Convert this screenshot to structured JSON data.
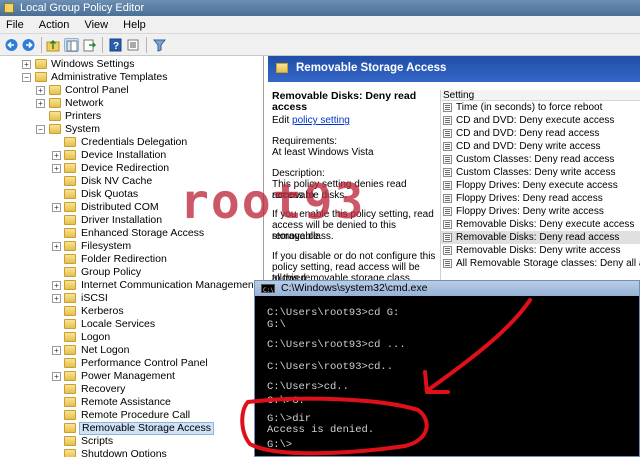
{
  "window": {
    "title": "Local Group Policy Editor"
  },
  "menu": [
    "File",
    "Action",
    "View",
    "Help"
  ],
  "toolbar": {
    "icons": [
      "back-arrow-icon",
      "forward-arrow-icon",
      "up-folder-icon",
      "show-hide-tree-icon",
      "export-list-icon",
      "help-icon",
      "properties-icon",
      "filter-icon"
    ]
  },
  "tree": {
    "items": [
      {
        "label": "Windows Settings",
        "exp": "+"
      },
      {
        "label": "Administrative Templates",
        "exp": "−"
      },
      {
        "label": "Control Panel",
        "exp": "+"
      },
      {
        "label": "Network",
        "exp": "+"
      },
      {
        "label": "Printers",
        "exp": ""
      },
      {
        "label": "System",
        "exp": "−"
      },
      {
        "label": "Credentials Delegation",
        "exp": ""
      },
      {
        "label": "Device Installation",
        "exp": "+"
      },
      {
        "label": "Device Redirection",
        "exp": "+"
      },
      {
        "label": "Disk NV Cache",
        "exp": ""
      },
      {
        "label": "Disk Quotas",
        "exp": ""
      },
      {
        "label": "Distributed COM",
        "exp": "+"
      },
      {
        "label": "Driver Installation",
        "exp": ""
      },
      {
        "label": "Enhanced Storage Access",
        "exp": ""
      },
      {
        "label": "Filesystem",
        "exp": "+"
      },
      {
        "label": "Folder Redirection",
        "exp": ""
      },
      {
        "label": "Group Policy",
        "exp": ""
      },
      {
        "label": "Internet Communication Management",
        "exp": "+"
      },
      {
        "label": "iSCSI",
        "exp": "+"
      },
      {
        "label": "Kerberos",
        "exp": ""
      },
      {
        "label": "Locale Services",
        "exp": ""
      },
      {
        "label": "Logon",
        "exp": ""
      },
      {
        "label": "Net Logon",
        "exp": "+"
      },
      {
        "label": "Performance Control Panel",
        "exp": ""
      },
      {
        "label": "Power Management",
        "exp": "+"
      },
      {
        "label": "Recovery",
        "exp": ""
      },
      {
        "label": "Remote Assistance",
        "exp": ""
      },
      {
        "label": "Remote Procedure Call",
        "exp": ""
      },
      {
        "label": "Removable Storage Access",
        "exp": ""
      },
      {
        "label": "Scripts",
        "exp": ""
      },
      {
        "label": "Shutdown Options",
        "exp": ""
      }
    ]
  },
  "right": {
    "header_title": "Removable Storage Access",
    "desc": {
      "heading": "Removable Disks: Deny read access",
      "edit_prefix": "Edit",
      "edit_link": "policy setting",
      "requirements_label": "Requirements:",
      "requirements_value": "At least Windows Vista",
      "description_label": "Description:",
      "p1a": "This policy setting denies read access to",
      "p1b": "removable disks.",
      "p2a": "If you enable this policy setting, read",
      "p2b": "access will be denied to this removable",
      "p2c": "storage class.",
      "p3a": "If you disable or do not configure this",
      "p3b": "policy setting, read access will be allowed",
      "p3c": "to this removable storage class."
    },
    "settings_header": "Setting",
    "settings": [
      "Time (in seconds) to force reboot",
      "CD and DVD: Deny execute access",
      "CD and DVD: Deny read access",
      "CD and DVD: Deny write access",
      "Custom Classes: Deny read access",
      "Custom Classes: Deny write access",
      "Floppy Drives: Deny execute access",
      "Floppy Drives: Deny read access",
      "Floppy Drives: Deny write access",
      "Removable Disks: Deny execute access",
      "Removable Disks: Deny read access",
      "Removable Disks: Deny write access",
      "All Removable Storage classes: Deny all access"
    ],
    "selected_setting_index": 10
  },
  "cmd": {
    "title": "C:\\Windows\\system32\\cmd.exe",
    "lines": [
      "C:\\Users\\root93>cd G:",
      "G:\\",
      "",
      "C:\\Users\\root93>cd ...",
      "",
      "C:\\Users\\root93>cd..",
      "",
      "C:\\Users>cd..",
      "",
      "C:\\>G:",
      "",
      "G:\\>dir",
      "Access is denied.",
      "",
      "G:\\>"
    ]
  },
  "watermark": "root93",
  "annotation_color": "#e0101a"
}
